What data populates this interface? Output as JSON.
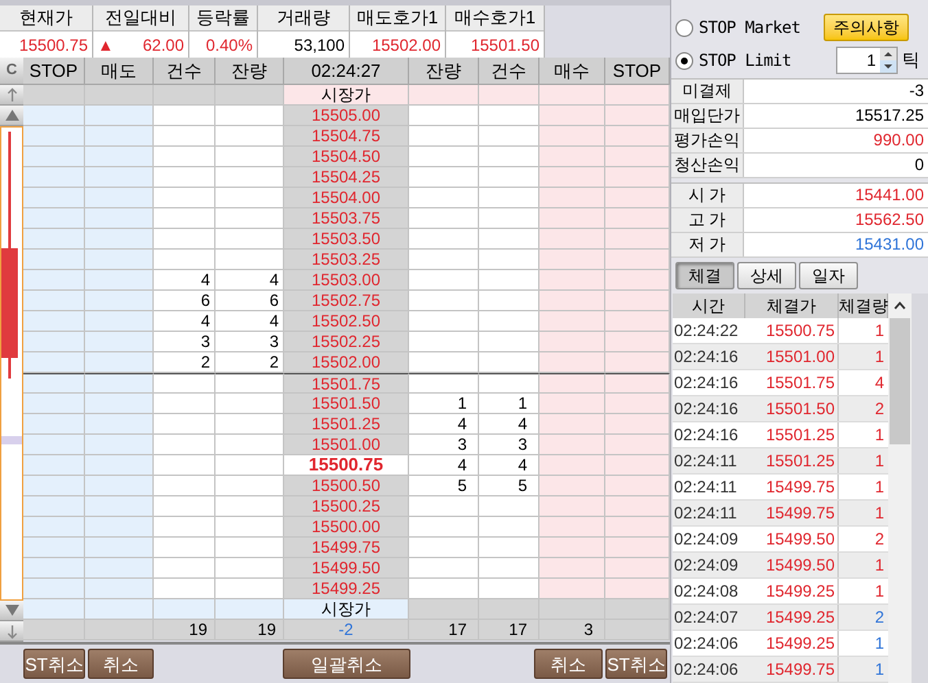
{
  "quote": {
    "columns": [
      {
        "label": "현재가",
        "value": "15500.75",
        "color": "#e0262e"
      },
      {
        "label": "전일대비",
        "value": "62.00",
        "color": "#e0262e",
        "mark": "▲"
      },
      {
        "label": "등락률",
        "value": "0.40%",
        "color": "#e0262e"
      },
      {
        "label": "거래량",
        "value": "53,100",
        "color": "#000000"
      },
      {
        "label": "매도호가1",
        "value": "15502.00",
        "color": "#e0262e"
      },
      {
        "label": "매수호가1",
        "value": "15501.50",
        "color": "#e0262e"
      }
    ]
  },
  "order_book": {
    "chart_button": "C",
    "columns": [
      "STOP",
      "매도",
      "건수",
      "잔량",
      "02:24:27",
      "잔량",
      "건수",
      "매수",
      "STOP"
    ],
    "top_market": "시장가",
    "bottom_market": "시장가",
    "rows": [
      {
        "price": "15505.00",
        "current": false
      },
      {
        "price": "15504.75",
        "current": false
      },
      {
        "price": "15504.50",
        "current": false
      },
      {
        "price": "15504.25",
        "current": false
      },
      {
        "price": "15504.00",
        "current": false
      },
      {
        "price": "15503.75",
        "current": false
      },
      {
        "price": "15503.50",
        "current": false
      },
      {
        "price": "15503.25",
        "current": false
      },
      {
        "price": "15503.00",
        "current": false,
        "ask_count": "4",
        "ask_qty": "4"
      },
      {
        "price": "15502.75",
        "current": false,
        "ask_count": "6",
        "ask_qty": "6"
      },
      {
        "price": "15502.50",
        "current": false,
        "ask_count": "4",
        "ask_qty": "4"
      },
      {
        "price": "15502.25",
        "current": false,
        "ask_count": "3",
        "ask_qty": "3"
      },
      {
        "price": "15502.00",
        "current": false,
        "ask_count": "2",
        "ask_qty": "2"
      },
      {
        "price": "15501.75",
        "current": false
      },
      {
        "price": "15501.50",
        "current": false,
        "bid_qty": "1",
        "bid_count": "1"
      },
      {
        "price": "15501.25",
        "current": false,
        "bid_qty": "4",
        "bid_count": "4"
      },
      {
        "price": "15501.00",
        "current": false,
        "bid_qty": "3",
        "bid_count": "3"
      },
      {
        "price": "15500.75",
        "current": true,
        "bid_qty": "4",
        "bid_count": "4"
      },
      {
        "price": "15500.50",
        "current": false,
        "bid_qty": "5",
        "bid_count": "5"
      },
      {
        "price": "15500.25",
        "current": false
      },
      {
        "price": "15500.00",
        "current": false
      },
      {
        "price": "15499.75",
        "current": false
      },
      {
        "price": "15499.50",
        "current": false
      },
      {
        "price": "15499.25",
        "current": false
      }
    ],
    "totals": {
      "ask_count": "19",
      "ask_qty": "19",
      "net": "-2",
      "bid_qty": "17",
      "bid_count": "17",
      "buy": "3"
    }
  },
  "bottom_buttons": {
    "left": [
      "ST취소",
      "취소"
    ],
    "center": "일괄취소",
    "right": [
      "취소",
      "ST취소"
    ]
  },
  "side": {
    "stop_types": [
      {
        "label": "STOP Market",
        "selected": false
      },
      {
        "label": "STOP Limit",
        "selected": true
      }
    ],
    "caution_button": "주의사항",
    "tick": {
      "value": "1",
      "unit": "틱"
    },
    "position": [
      {
        "label": "미결제",
        "value": "-3",
        "color": "#000000"
      },
      {
        "label": "매입단가",
        "value": "15517.25",
        "color": "#000000"
      },
      {
        "label": "평가손익",
        "value": "990.00",
        "color": "#e0262e"
      },
      {
        "label": "청산손익",
        "value": "0",
        "color": "#000000"
      }
    ],
    "prices": [
      {
        "label": "시 가",
        "value": "15441.00",
        "color": "#e0262e"
      },
      {
        "label": "고 가",
        "value": "15562.50",
        "color": "#e0262e"
      },
      {
        "label": "저 가",
        "value": "15431.00",
        "color": "#2f74d8"
      }
    ],
    "tabs": [
      {
        "label": "체결",
        "selected": true
      },
      {
        "label": "상세",
        "selected": false
      },
      {
        "label": "일자",
        "selected": false
      }
    ],
    "trades": {
      "columns": [
        "시간",
        "체결가",
        "체결량"
      ],
      "rows": [
        {
          "time": "02:24:22",
          "price": "15500.75",
          "qty": "1",
          "color": "#e0262e"
        },
        {
          "time": "02:24:16",
          "price": "15501.00",
          "qty": "1",
          "color": "#e0262e"
        },
        {
          "time": "02:24:16",
          "price": "15501.75",
          "qty": "4",
          "color": "#e0262e"
        },
        {
          "time": "02:24:16",
          "price": "15501.50",
          "qty": "2",
          "color": "#e0262e"
        },
        {
          "time": "02:24:16",
          "price": "15501.25",
          "qty": "1",
          "color": "#e0262e"
        },
        {
          "time": "02:24:11",
          "price": "15501.25",
          "qty": "1",
          "color": "#e0262e"
        },
        {
          "time": "02:24:11",
          "price": "15499.75",
          "qty": "1",
          "color": "#e0262e"
        },
        {
          "time": "02:24:11",
          "price": "15499.75",
          "qty": "1",
          "color": "#e0262e"
        },
        {
          "time": "02:24:09",
          "price": "15499.50",
          "qty": "2",
          "color": "#e0262e"
        },
        {
          "time": "02:24:09",
          "price": "15499.50",
          "qty": "1",
          "color": "#e0262e"
        },
        {
          "time": "02:24:08",
          "price": "15499.25",
          "qty": "1",
          "color": "#e0262e"
        },
        {
          "time": "02:24:07",
          "price": "15499.25",
          "qty": "2",
          "color": "#2f74d8"
        },
        {
          "time": "02:24:06",
          "price": "15499.25",
          "qty": "1",
          "color": "#2f74d8"
        },
        {
          "time": "02:24:06",
          "price": "15499.75",
          "qty": "1",
          "color": "#2f74d8"
        }
      ]
    }
  }
}
